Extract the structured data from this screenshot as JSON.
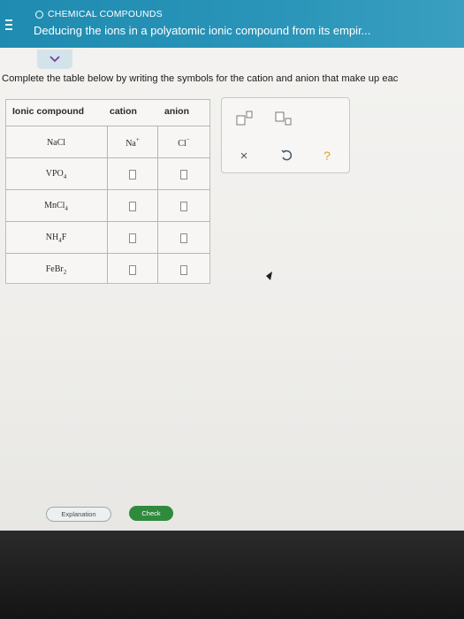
{
  "header": {
    "topic": "CHEMICAL COMPOUNDS",
    "title": "Deducing the ions in a polyatomic ionic compound from its empir..."
  },
  "instruction": "Complete the table below by writing the symbols for the cation and anion that make up eac",
  "table": {
    "headers": [
      "Ionic compound",
      "cation",
      "anion"
    ],
    "rows": [
      {
        "compound": "NaCl",
        "cation": "Na",
        "cation_charge": "+",
        "anion": "Cl",
        "anion_charge": "−"
      },
      {
        "compound_base": "VPO",
        "compound_sub": "4"
      },
      {
        "compound_base": "MnCl",
        "compound_sub": "4"
      },
      {
        "compound_a": "NH",
        "compound_sub": "4",
        "compound_b": "F"
      },
      {
        "compound_base": "FeBr",
        "compound_sub": "2"
      }
    ]
  },
  "tools": {
    "clear_symbol": "×",
    "help_symbol": "?"
  },
  "buttons": {
    "explanation": "Explanation",
    "check": "Check"
  },
  "colors": {
    "header_bg": "#2a95b9",
    "check_bg": "#2f8a3c",
    "help_color": "#e0a020",
    "undo_color": "#4a5a66"
  }
}
